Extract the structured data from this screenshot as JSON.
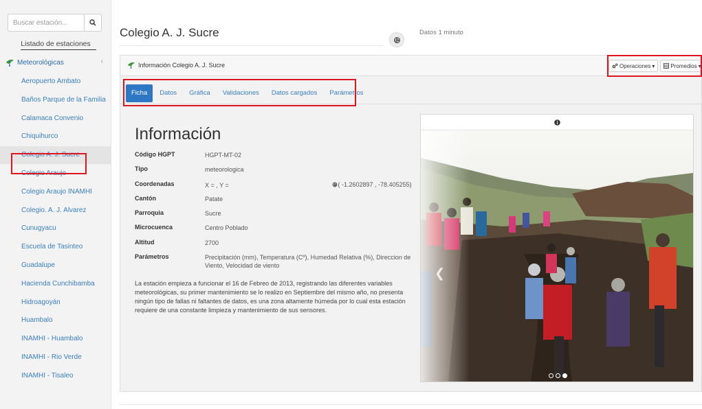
{
  "sidebar": {
    "search_placeholder": "Buscar estación...",
    "list_title": "Listado de estaciones",
    "category": "Meteorológicas",
    "stations": [
      {
        "label": "Aeropuerto Ambato"
      },
      {
        "label": "Baños Parque de la Familia"
      },
      {
        "label": "Calamaca Convenio"
      },
      {
        "label": "Chiquihurco"
      },
      {
        "label": "Colegio A. J. Sucre",
        "active": true
      },
      {
        "label": "Colegio Araujo"
      },
      {
        "label": "Colegio Araujo INAMHI"
      },
      {
        "label": "Colegio. A. J. Alvarez"
      },
      {
        "label": "Cunugyacu"
      },
      {
        "label": "Escuela de Tasinteo"
      },
      {
        "label": "Guadalupe"
      },
      {
        "label": "Hacienda Cunchibamba"
      },
      {
        "label": "Hidroagoyán"
      },
      {
        "label": "Huambalo"
      },
      {
        "label": "INAMHI - Huambalo"
      },
      {
        "label": "INAMHI - Rio Verde"
      },
      {
        "label": "INAMHI - Tisaleo"
      }
    ]
  },
  "header": {
    "title": "Colegio A. J. Sucre",
    "interval": "Datos 1 minuto"
  },
  "panel": {
    "title": "Información Colegio A. J. Sucre",
    "operations_label": "Operaciones",
    "averages_label": "Promedios",
    "tabs": [
      {
        "label": "Ficha",
        "active": true
      },
      {
        "label": "Datos"
      },
      {
        "label": "Gráfica"
      },
      {
        "label": "Validaciones"
      },
      {
        "label": "Datos cargados"
      },
      {
        "label": "Parámetros"
      }
    ]
  },
  "info": {
    "heading": "Información",
    "code_label": "Código HGPT",
    "code_value": "HGPT-MT-02",
    "type_label": "Tipo",
    "type_value": "meteorologica",
    "coords_label": "Coordenadas",
    "coords_xy": "X = , Y =",
    "coords_point": "( -1.2602897 , -78.405255)",
    "canton_label": "Cantón",
    "canton_value": "Patate",
    "parish_label": "Parroquia",
    "parish_value": "Sucre",
    "basin_label": "Microcuenca",
    "basin_value": "Centro Poblado",
    "altitude_label": "Altitud",
    "altitude_value": "2700",
    "params_label": "Parámetros",
    "params_value": "Precipitación (mm), Temperatura (Cº), Humedad Relativa (%), Direccion de Viento, Velocidad de viento",
    "description": "La estación empieza a funcionar el 16 de Febreo de 2013, registrando las diferentes variables meteorológicas, su primer mantenimiento se lo realizo en Septiembre del mismo año, no presenta ningún tipo de fallas ni faltantes de datos, es una zona altamente húmeda por lo cual esta estación requiere de una constante limpieza y mantenimiento de sus sensores."
  },
  "carousel": {
    "slide_count": 3,
    "active_slide": 3
  },
  "colors": {
    "highlight": "#e0141e",
    "accent": "#2e77c4",
    "link": "#3a7fc2"
  }
}
